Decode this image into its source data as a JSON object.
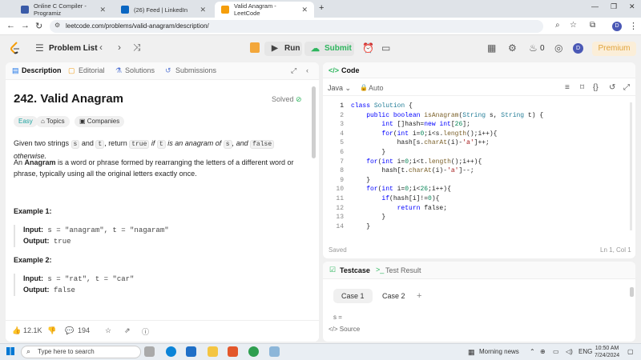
{
  "browser": {
    "tabs": [
      {
        "title": "Online C Compiler - Programiz",
        "color": "#3a5ba8"
      },
      {
        "title": "(26) Feed | LinkedIn",
        "color": "#0a66c2"
      },
      {
        "title": "Valid Anagram - LeetCode",
        "color": "#f59e0b"
      }
    ],
    "new_tab": "+",
    "url": "leetcode.com/problems/valid-anagram/description/"
  },
  "lc_nav": {
    "problem_list": "Problem List",
    "run": "Run",
    "submit": "Submit",
    "streak": "0",
    "avatar_initial": "D",
    "premium": "Premium"
  },
  "left_tabs": [
    "Description",
    "Editorial",
    "Solutions",
    "Submissions"
  ],
  "problem": {
    "title": "242. Valid Anagram",
    "status": "Solved",
    "difficulty": "Easy",
    "topics_label": "Topics",
    "companies_label": "Companies",
    "desc_parts": [
      "Given two strings ",
      "s",
      " and ",
      "t",
      ", return ",
      "true",
      " if ",
      "t",
      " is an anagram of ",
      "s",
      ", and ",
      "false",
      " otherwise."
    ],
    "anagram_term": "Anagram",
    "anagram_def_prefix": "An ",
    "anagram_def": " is a word or phrase formed by rearranging the letters of a different word or phrase, typically using all the original letters exactly once.",
    "examples": [
      {
        "heading": "Example 1:",
        "input_label": "Input:",
        "input": "s = \"anagram\", t = \"nagaram\"",
        "output_label": "Output:",
        "output": "true"
      },
      {
        "heading": "Example 2:",
        "input_label": "Input:",
        "input": "s = \"rat\", t = \"car\"",
        "output_label": "Output:",
        "output": "false"
      }
    ]
  },
  "footer": {
    "likes": "12.1K",
    "comments": "194"
  },
  "code": {
    "header": "Code",
    "language": "Java",
    "mode": "Auto",
    "saved": "Saved",
    "cursor": "Ln 1, Col 1",
    "lines": [
      "class Solution {",
      "    public boolean isAnagram(String s, String t) {",
      "        int []hash=new int[26];",
      "        for(int i=0;i<s.length();i++){",
      "            hash[s.charAt(i)-'a']++;",
      "        }",
      "    for(int i=0;i<t.length();i++){",
      "        hash[t.charAt(i)-'a']--;",
      "    }",
      "    for(int i=0;i<26;i++){",
      "        if(hash[i]!=0){",
      "            return false;",
      "        }",
      "    }"
    ],
    "line_numbers": [
      "1",
      "2",
      "3",
      "4",
      "5",
      "6",
      "7",
      "8",
      "9",
      "10",
      "11",
      "12",
      "13",
      "14"
    ]
  },
  "testcase": {
    "tab_testcase": "Testcase",
    "tab_result": "Test Result",
    "cases": [
      "Case 1",
      "Case 2"
    ],
    "add": "+",
    "var_label": "s =",
    "source": "Source"
  },
  "taskbar": {
    "search_placeholder": "Type here to search",
    "news": "Morning news",
    "lang": "ENG",
    "time": "10:50 AM",
    "date": "7/24/2024"
  },
  "colors": {
    "accent_green": "#2db55d",
    "easy": "#1ca3a0",
    "premium": "#e1a33a",
    "keyword": "#0000ff"
  }
}
